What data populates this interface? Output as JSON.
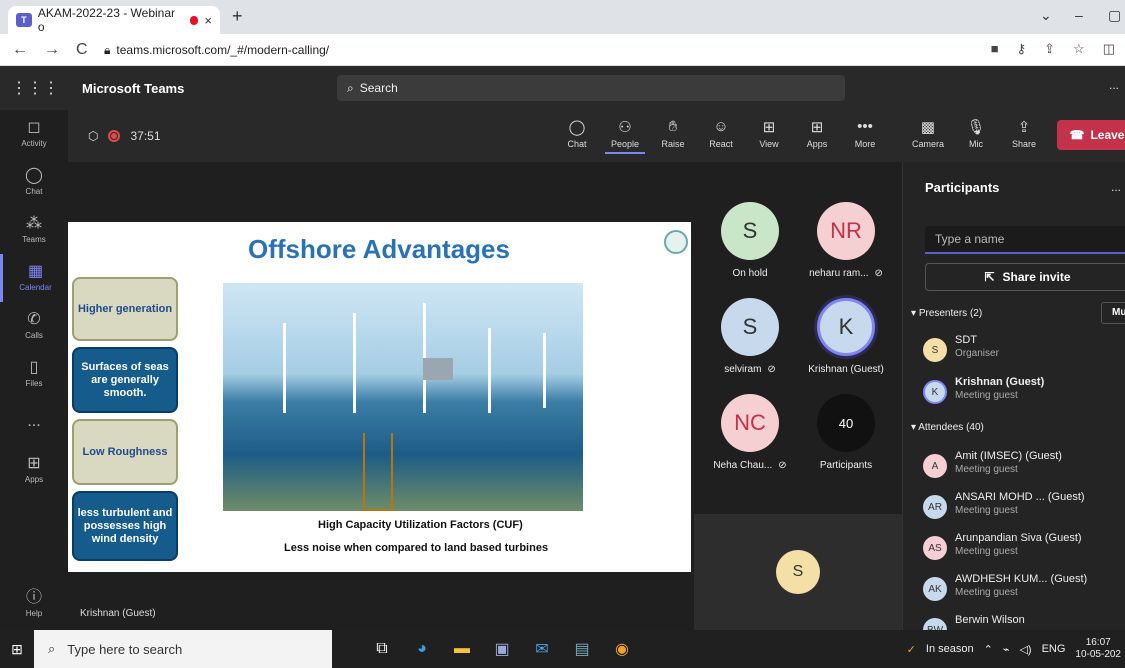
{
  "browser": {
    "tab_title": "AKAM-2022-23 - Webinar o",
    "tab_close": "×",
    "new_tab": "+",
    "url": "teams.microsoft.com/_#/modern-calling/"
  },
  "teams": {
    "app_name": "Microsoft Teams",
    "search_label": "Search",
    "more": "..."
  },
  "rail": [
    {
      "label": "Activity",
      "icon": "bell-icon"
    },
    {
      "label": "Chat",
      "icon": "chat-icon"
    },
    {
      "label": "Teams",
      "icon": "teams-icon"
    },
    {
      "label": "Calendar",
      "icon": "calendar-icon"
    },
    {
      "label": "Calls",
      "icon": "phone-icon"
    },
    {
      "label": "Files",
      "icon": "file-icon"
    },
    {
      "label": "Apps",
      "icon": "apps-icon"
    },
    {
      "label": "Help",
      "icon": "help-icon"
    }
  ],
  "rail_more": "...",
  "meeting": {
    "timer": "37:51",
    "controls": {
      "chat": "Chat",
      "people": "People",
      "raise": "Raise",
      "react": "React",
      "view": "View",
      "apps": "Apps",
      "more": "More",
      "camera": "Camera",
      "mic": "Mic",
      "share": "Share",
      "leave": "Leave"
    }
  },
  "slide": {
    "title": "Offshore Advantages",
    "boxes": [
      "Higher generation",
      "Surfaces of seas are generally smooth.",
      "Low Roughness",
      "less turbulent and possesses high wind density"
    ],
    "caption1": "High Capacity Utilization Factors (CUF)",
    "caption2": "Less noise when compared to land based turbines"
  },
  "presenter_tag": "Krishnan (Guest)",
  "gallery": [
    {
      "initials": "S",
      "name": "On hold",
      "color": "#c9e6c9"
    },
    {
      "initials": "NR",
      "name": "neharu ram...",
      "color": "#f6cfd3"
    },
    {
      "initials": "S",
      "name": "selviram",
      "color": "#c7d9ec"
    },
    {
      "initials": "K",
      "name": "Krishnan (Guest)",
      "color": "#c7d9ec"
    },
    {
      "initials": "NC",
      "name": "Neha Chau...",
      "color": "#f6cfd3"
    },
    {
      "initials": "40",
      "name": "Participants",
      "color": "#111111"
    }
  ],
  "self_initial": "S",
  "participants": {
    "title": "Participants",
    "more": "...",
    "input_placeholder": "Type a name",
    "share_invite": "Share invite",
    "presenters_label": "Presenters (2)",
    "mute_label": "Mu",
    "attendees_label": "Attendees (40)",
    "presenters": [
      {
        "initials": "S",
        "name": "SDT",
        "role": "Organiser",
        "color": "#f4dfa7"
      },
      {
        "initials": "K",
        "name": "Krishnan (Guest)",
        "role": "Meeting guest",
        "color": "#c7d9ec"
      }
    ],
    "attendees": [
      {
        "initials": "A",
        "name": "Amit (IMSEC) (Guest)",
        "role": "Meeting guest",
        "color": "#f6cfd3"
      },
      {
        "initials": "AR",
        "name": "ANSARI MOHD ... (Guest)",
        "role": "Meeting guest",
        "color": "#c7d9ec"
      },
      {
        "initials": "AS",
        "name": "Arunpandian Siva (Guest)",
        "role": "Meeting guest",
        "color": "#f6cfd3"
      },
      {
        "initials": "AK",
        "name": "AWDHESH KUM... (Guest)",
        "role": "Meeting guest",
        "color": "#c7d9ec"
      },
      {
        "initials": "BW",
        "name": "Berwin Wilson",
        "role": "",
        "color": "#c7d9ec"
      }
    ]
  },
  "taskbar": {
    "search": "Type here to search",
    "weather": "In season",
    "lang": "ENG",
    "time": "16:07",
    "date": "10-05-202"
  }
}
